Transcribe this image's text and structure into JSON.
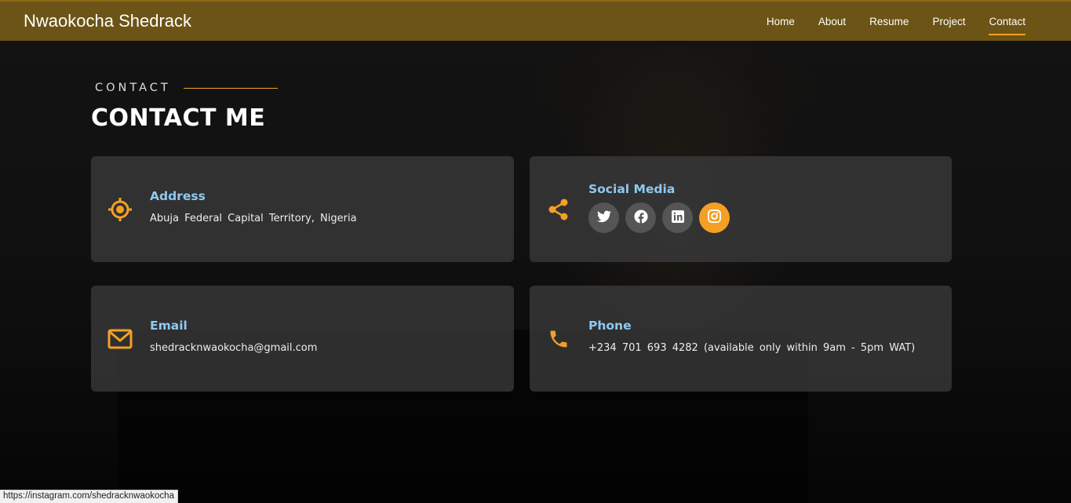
{
  "header": {
    "brand": "Nwaokocha Shedrack",
    "nav": [
      "Home",
      "About",
      "Resume",
      "Project",
      "Contact"
    ],
    "active_nav": "Contact"
  },
  "section": {
    "eyebrow": "CONTACT",
    "title": "CONTACT ME"
  },
  "cards": {
    "address": {
      "label": "Address",
      "value": "Abuja Federal Capital Territory, Nigeria",
      "icon": "location-target-icon"
    },
    "social": {
      "label": "Social Media",
      "icon": "share-icon",
      "links": [
        "twitter-icon",
        "facebook-icon",
        "linkedin-icon",
        "instagram-icon"
      ],
      "active": "instagram-icon"
    },
    "email": {
      "label": "Email",
      "value": "shedracknwaokocha@gmail.com",
      "icon": "envelope-icon"
    },
    "phone": {
      "label": "Phone",
      "value": "+234 701 693 4282 (available only within 9am - 5pm WAT)",
      "icon": "phone-icon"
    }
  },
  "status_bar": {
    "url": "https://instagram.com/shedracknwaokocha"
  },
  "colors": {
    "accent": "#f4a025",
    "label_blue": "#8ecaf0",
    "header_bg": "#6c5416"
  }
}
